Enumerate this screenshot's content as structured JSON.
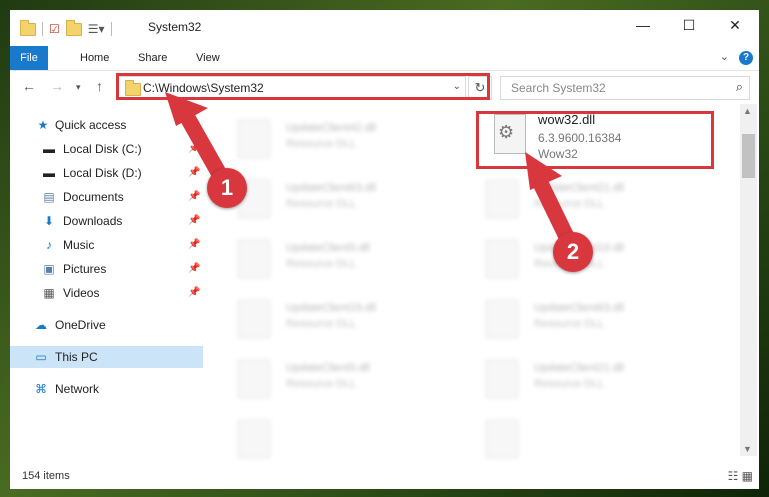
{
  "window": {
    "title": "System32",
    "minimize": "—",
    "maximize": "☐",
    "close": "✕"
  },
  "ribbon": {
    "tabs": [
      "File",
      "Home",
      "Share",
      "View"
    ],
    "help": "?"
  },
  "address": {
    "path": "C:\\Windows\\System32",
    "search_placeholder": "Search System32"
  },
  "nav": {
    "items": [
      {
        "label": "Quick access",
        "icon": "star-icon"
      },
      {
        "label": "Local Disk (C:)",
        "icon": "drive-icon"
      },
      {
        "label": "Local Disk (D:)",
        "icon": "drive-icon"
      },
      {
        "label": "Documents",
        "icon": "documents-icon"
      },
      {
        "label": "Downloads",
        "icon": "downloads-icon"
      },
      {
        "label": "Music",
        "icon": "music-icon"
      },
      {
        "label": "Pictures",
        "icon": "pictures-icon"
      },
      {
        "label": "Videos",
        "icon": "videos-icon"
      },
      {
        "label": "OneDrive",
        "icon": "cloud-icon"
      },
      {
        "label": "This PC",
        "icon": "pc-icon"
      },
      {
        "label": "Network",
        "icon": "network-icon"
      }
    ]
  },
  "files": {
    "highlighted": {
      "name": "wow32.dll",
      "version": "6.3.9600.16384",
      "description": "Wow32"
    },
    "blurred": [
      {
        "name": "UpdateClient42.dll",
        "desc": "Resource DLL"
      },
      {
        "name": "UpdateClient63.dll",
        "desc": "Resource DLL"
      },
      {
        "name": "UpdateClient21.dll",
        "desc": "Resource DLL"
      },
      {
        "name": "UpdateClient5.dll",
        "desc": "Resource DLL"
      },
      {
        "name": "UpdateClient19.dll",
        "desc": "Resource DLL"
      },
      {
        "name": "UpdateClient19.dll",
        "desc": "Resource DLL"
      },
      {
        "name": "UpdateClient63.dll",
        "desc": "Resource DLL"
      },
      {
        "name": "UpdateClient5.dll",
        "desc": "Resource DLL"
      },
      {
        "name": "UpdateClient21.dll",
        "desc": "Resource DLL"
      }
    ]
  },
  "status": {
    "count": "154 items"
  },
  "annotations": {
    "step1": "1",
    "step2": "2",
    "color": "#d9373e"
  }
}
